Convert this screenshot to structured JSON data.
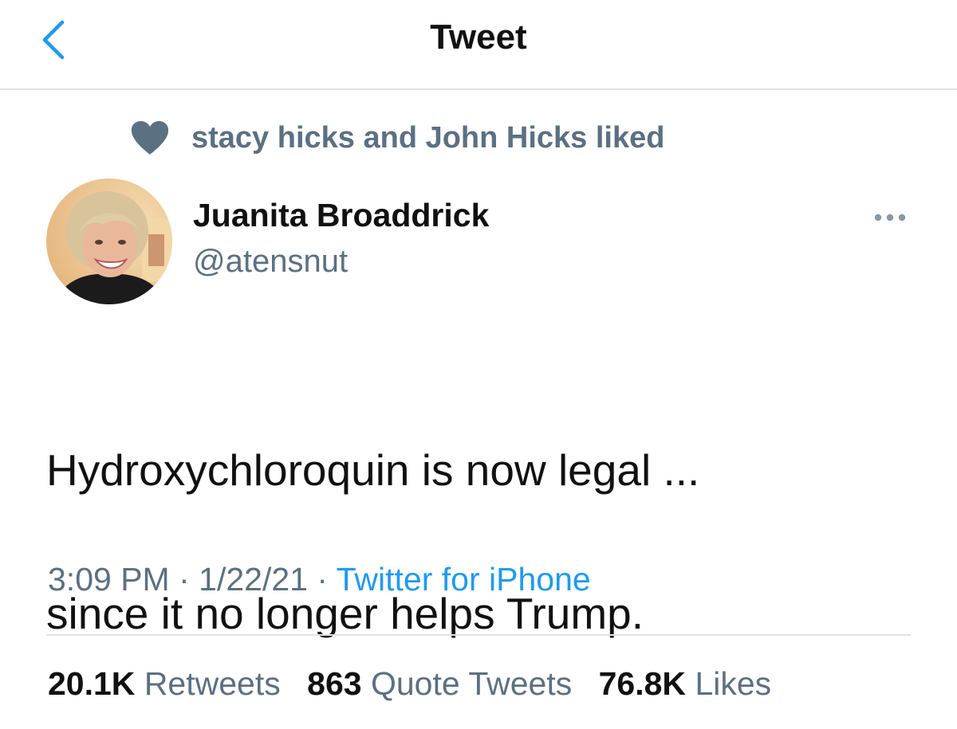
{
  "header": {
    "title": "Tweet",
    "back_icon": "chevron-left-icon",
    "accent_color": "#1d9bf0"
  },
  "social_context": {
    "icon": "heart-icon",
    "text": "stacy hicks and John Hicks liked"
  },
  "author": {
    "display_name": "Juanita Broaddrick",
    "handle": "@atensnut"
  },
  "tweet": {
    "text_line1": "Hydroxychloroquin is now legal ...",
    "text_line2": "since it no longer helps Trump."
  },
  "meta": {
    "time": "3:09 PM",
    "sep1": " · ",
    "date": "1/22/21",
    "sep2": " · ",
    "source": "Twitter for iPhone"
  },
  "stats": {
    "retweets_count": "20.1K",
    "retweets_label": "Retweets",
    "quotes_count": "863",
    "quotes_label": "Quote Tweets",
    "likes_count": "76.8K",
    "likes_label": "Likes"
  },
  "colors": {
    "text_primary": "#111111",
    "text_secondary": "#5b7083",
    "link": "#1d9bf0",
    "divider": "#dfe3e7"
  }
}
